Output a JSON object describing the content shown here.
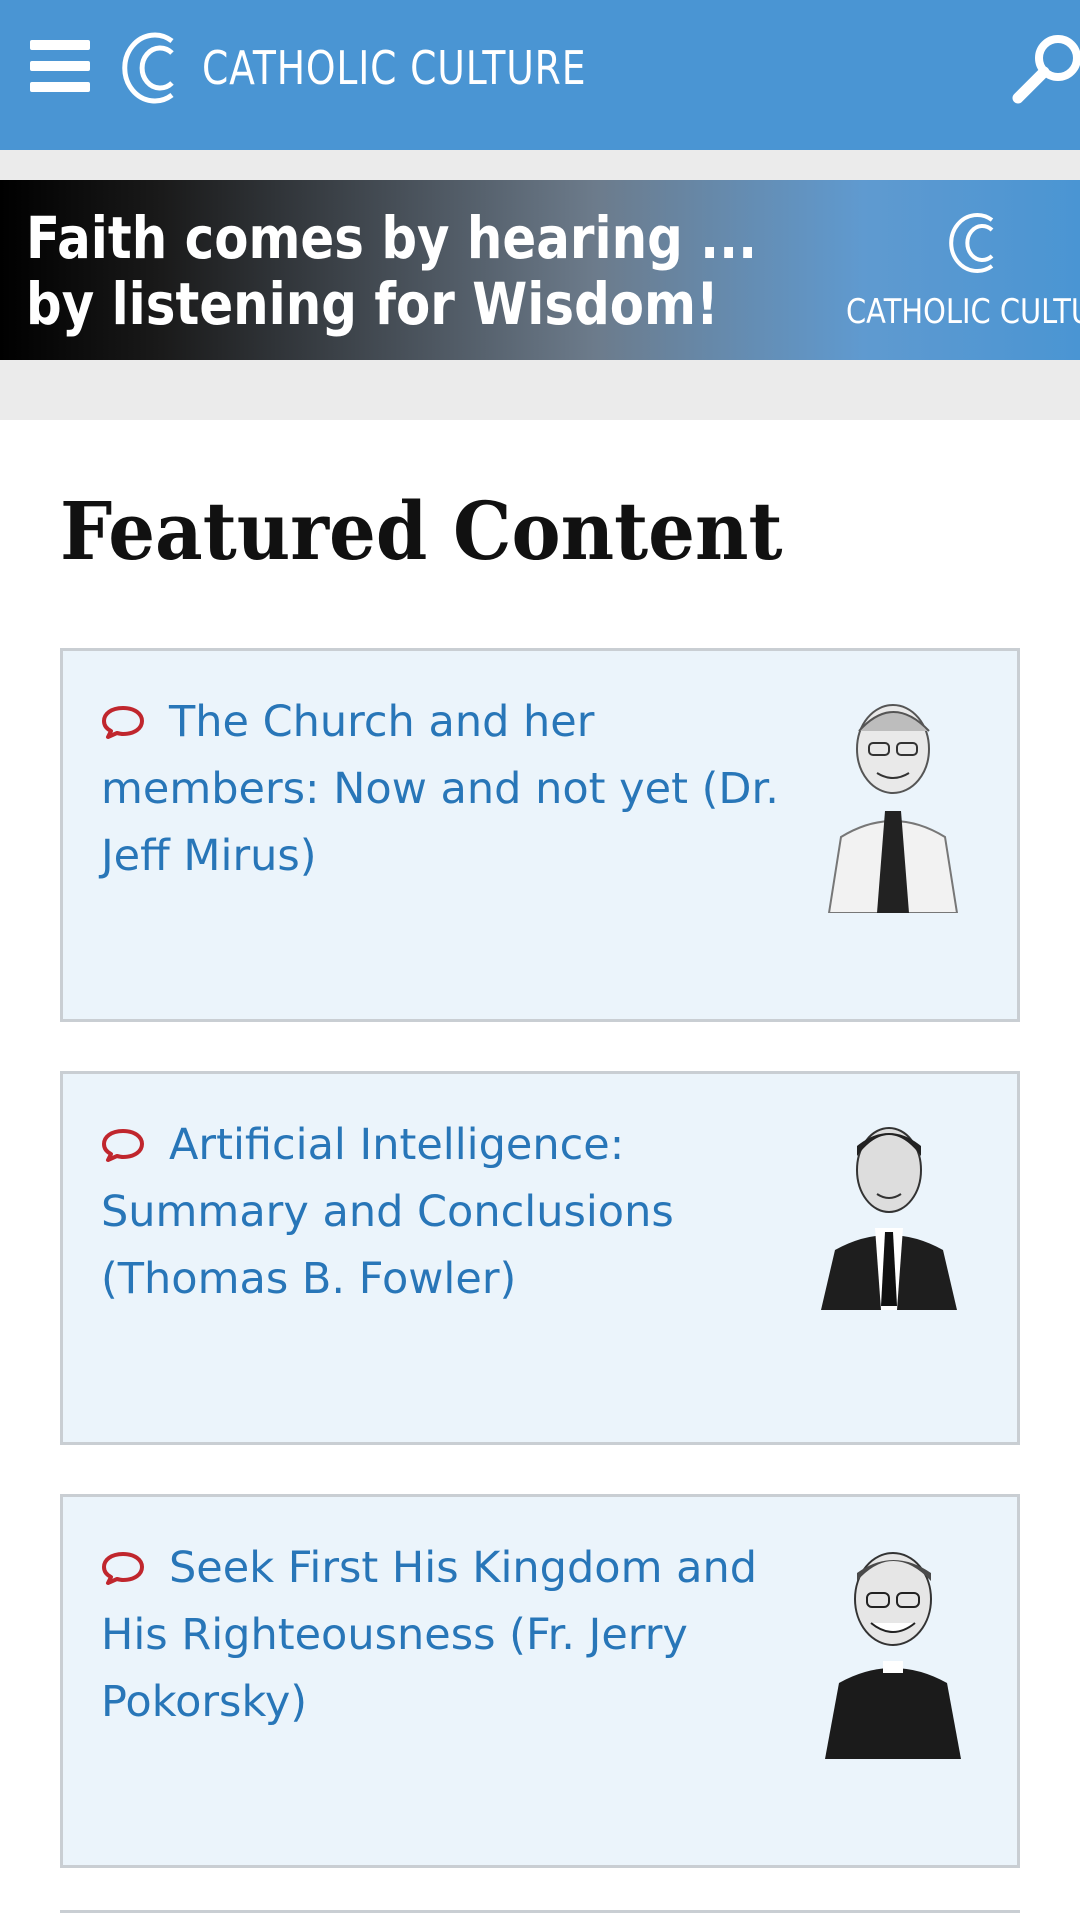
{
  "header": {
    "brand": "CATHOLIC CULTURE",
    "menu_icon": "hamburger-icon",
    "search_icon": "search-icon",
    "bg_color": "#4a95d3"
  },
  "banner": {
    "line1": "Faith comes by hearing ...",
    "line2": "by listening for Wisdom!",
    "brand": "CATHOLIC CULTURE"
  },
  "main": {
    "title": "Featured Content",
    "items": [
      {
        "title": "The Church and her members: Now and not yet (Dr. Jeff Mirus)",
        "icon": "comment-icon",
        "avatar": "portrait-jeff-mirus"
      },
      {
        "title": "Artificial Intelligence: Summary and Conclusions (Thomas B. Fowler)",
        "icon": "comment-icon",
        "avatar": "portrait-thomas-fowler"
      },
      {
        "title": "Seek First His Kingdom and His Righteousness (Fr. Jerry Pokorsky)",
        "icon": "comment-icon",
        "avatar": "portrait-jerry-pokorsky"
      }
    ]
  },
  "colors": {
    "link": "#2876b8",
    "icon_red": "#c0262d",
    "card_bg": "#ebf4fb"
  }
}
